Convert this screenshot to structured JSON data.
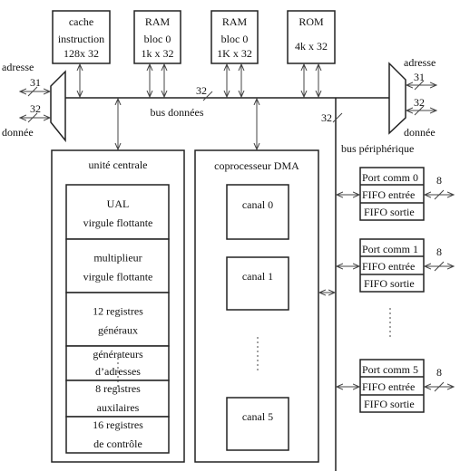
{
  "memories": [
    {
      "lines": [
        "cache",
        "instruction",
        "128x 32"
      ]
    },
    {
      "lines": [
        "RAM",
        "bloc 0",
        "1k x 32"
      ]
    },
    {
      "lines": [
        "RAM",
        "bloc 0",
        "1K x 32"
      ]
    },
    {
      "lines": [
        "ROM",
        "4k x 32"
      ]
    }
  ],
  "left_port": {
    "address": "adresse",
    "address_width": "31",
    "data_width": "32",
    "data": "donnée"
  },
  "right_port": {
    "address": "adresse",
    "address_width": "31",
    "data_width": "32",
    "data": "donnée"
  },
  "data_bus": {
    "label": "bus données",
    "width": "32"
  },
  "peripheral_bus": {
    "label": "bus périphérique",
    "width": "32"
  },
  "cpu": {
    "title": "unité centrale",
    "blocks": [
      {
        "lines": [
          "UAL",
          "virgule flottante"
        ]
      },
      {
        "lines": [
          "multiplieur",
          "virgule flottante"
        ]
      },
      {
        "lines": [
          "12 registres",
          "généraux"
        ]
      },
      {
        "lines": [
          "générateurs",
          "d’adresses"
        ]
      },
      {
        "lines": [
          "8 registres",
          "auxilaires"
        ]
      },
      {
        "lines": [
          "16 registres",
          "de contrôle"
        ]
      }
    ]
  },
  "dma": {
    "title": "coprocesseur DMA",
    "channels": [
      "canal 0",
      "canal 1",
      "canal 5"
    ]
  },
  "comm_ports": [
    {
      "name": "Port comm 0",
      "fifo_in": "FIFO entrée",
      "fifo_out": "FIFO sortie",
      "width": "8"
    },
    {
      "name": "Port comm 1",
      "fifo_in": "FIFO entrée",
      "fifo_out": "FIFO sortie",
      "width": "8"
    },
    {
      "name": "Port comm 5",
      "fifo_in": "FIFO entrée",
      "fifo_out": "FIFO sortie",
      "width": "8"
    }
  ]
}
